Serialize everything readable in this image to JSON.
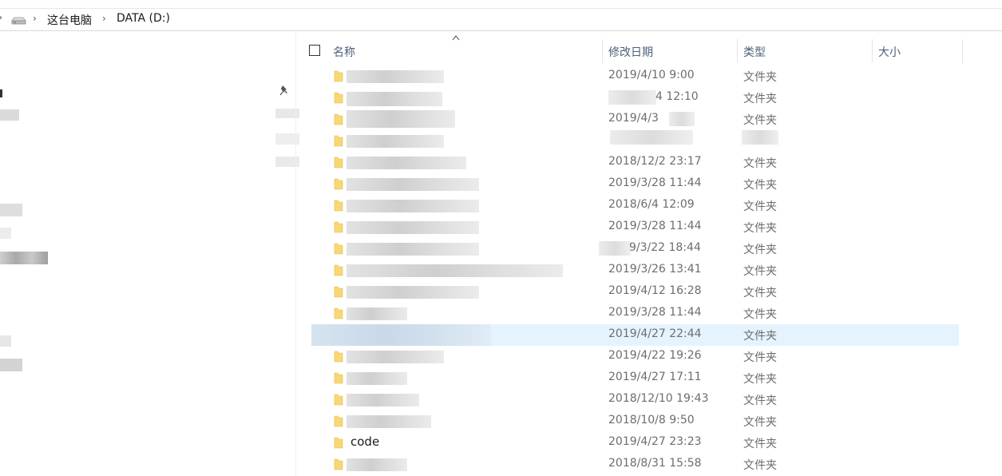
{
  "breadcrumb": {
    "items": [
      "这台电脑",
      "DATA (D:)"
    ]
  },
  "columns": {
    "name": "名称",
    "date": "修改日期",
    "type": "类型",
    "size": "大小"
  },
  "files": [
    {
      "name": "",
      "date": "2019/4/10 9:00",
      "type": "文件夹"
    },
    {
      "name": "",
      "date": "4 12:10",
      "type": "文件夹"
    },
    {
      "name": "",
      "date": "2019/4/3",
      "type": "文件夹"
    },
    {
      "name": "",
      "date": "",
      "type": ""
    },
    {
      "name": "",
      "date": "2018/12/2 23:17",
      "type": "文件夹"
    },
    {
      "name": "",
      "date": "2019/3/28 11:44",
      "type": "文件夹"
    },
    {
      "name": "",
      "date": "2018/6/4 12:09",
      "type": "文件夹"
    },
    {
      "name": "",
      "date": "2019/3/28 11:44",
      "type": "文件夹"
    },
    {
      "name": "",
      "date": "9/3/22 18:44",
      "type": "文件夹"
    },
    {
      "name": "",
      "date": "2019/3/26 13:41",
      "type": "文件夹"
    },
    {
      "name": "",
      "date": "2019/4/12 16:28",
      "type": "文件夹"
    },
    {
      "name": "",
      "date": "2019/3/28 11:44",
      "type": "文件夹"
    },
    {
      "name": "",
      "date": "2019/4/27 22:44",
      "type": "文件夹",
      "selected": true
    },
    {
      "name": "",
      "date": "2019/4/22 19:26",
      "type": "文件夹"
    },
    {
      "name": "",
      "date": "2019/4/27 17:11",
      "type": "文件夹"
    },
    {
      "name": "",
      "date": "2018/12/10 19:43",
      "type": "文件夹"
    },
    {
      "name": "",
      "date": "2018/10/8 9:50",
      "type": "文件夹"
    },
    {
      "name": "code",
      "date": "2019/4/27 23:23",
      "type": "文件夹"
    },
    {
      "name": "",
      "date": "2018/8/31 15:58",
      "type": "文件夹"
    }
  ],
  "colors": {
    "selected_row": "#e5f3ff",
    "header_text": "#4c607a",
    "folder": "#f8d775"
  }
}
